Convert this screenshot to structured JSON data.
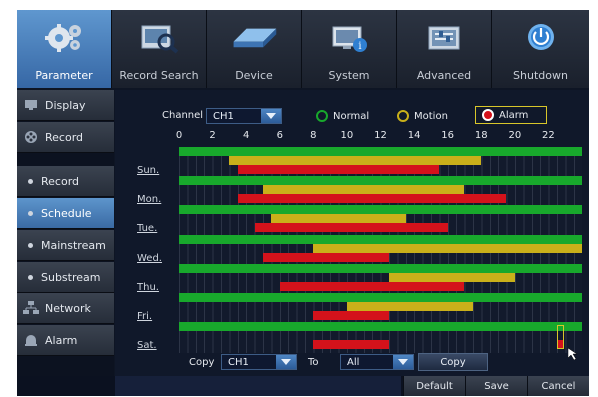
{
  "tabs": [
    {
      "label": "Parameter",
      "icon": "gears-icon",
      "active": true
    },
    {
      "label": "Record Search",
      "icon": "record-search-icon"
    },
    {
      "label": "Device",
      "icon": "hard-drive-icon"
    },
    {
      "label": "System",
      "icon": "system-info-icon"
    },
    {
      "label": "Advanced",
      "icon": "advanced-settings-icon"
    },
    {
      "label": "Shutdown",
      "icon": "power-icon"
    }
  ],
  "sidebar": {
    "items": [
      {
        "label": "Display",
        "icon": "monitor-icon"
      },
      {
        "label": "Record",
        "icon": "film-reel-icon"
      },
      {
        "label": "Record"
      },
      {
        "label": "Schedule",
        "selected": true
      },
      {
        "label": "Mainstream"
      },
      {
        "label": "Substream"
      },
      {
        "label": "Network",
        "icon": "network-icon"
      },
      {
        "label": "Alarm",
        "icon": "alarm-icon"
      }
    ]
  },
  "schedule": {
    "channel_label": "Channel",
    "channel_value": "CH1",
    "legend": {
      "normal": "Normal",
      "motion": "Motion",
      "alarm": "Alarm",
      "selected": "alarm"
    },
    "colors": {
      "normal": "#18a82c",
      "motion": "#c9b01a",
      "alarm": "#d4121b"
    },
    "hour_labels": [
      "0",
      "2",
      "4",
      "6",
      "8",
      "10",
      "12",
      "14",
      "16",
      "18",
      "20",
      "22"
    ],
    "days": [
      {
        "label": "Sun.",
        "normal": [
          [
            0,
            24
          ]
        ],
        "motion": [
          [
            3,
            18
          ]
        ],
        "alarm": [
          [
            3.5,
            15.5
          ]
        ]
      },
      {
        "label": "Mon.",
        "normal": [
          [
            0,
            24
          ]
        ],
        "motion": [
          [
            5,
            17
          ]
        ],
        "alarm": [
          [
            3.5,
            19.5
          ]
        ]
      },
      {
        "label": "Tue.",
        "normal": [
          [
            0,
            24
          ]
        ],
        "motion": [
          [
            5.5,
            13.5
          ]
        ],
        "alarm": [
          [
            4.5,
            16
          ]
        ]
      },
      {
        "label": "Wed.",
        "normal": [
          [
            0,
            24
          ]
        ],
        "motion": [
          [
            8,
            24
          ]
        ],
        "alarm": [
          [
            5,
            12.5
          ]
        ]
      },
      {
        "label": "Thu.",
        "normal": [
          [
            0,
            24
          ]
        ],
        "motion": [
          [
            12.5,
            20
          ]
        ],
        "alarm": [
          [
            6,
            17
          ]
        ]
      },
      {
        "label": "Fri.",
        "normal": [
          [
            0,
            24
          ]
        ],
        "motion": [
          [
            10,
            17.5
          ]
        ],
        "alarm": [
          [
            8,
            12.5
          ]
        ]
      },
      {
        "label": "Sat.",
        "normal": [
          [
            0,
            24
          ]
        ],
        "motion": [],
        "alarm": [
          [
            8,
            12.5
          ]
        ]
      }
    ],
    "copy_label": "Copy",
    "copy_from": "CH1",
    "to_label": "To",
    "copy_to": "All",
    "copy_button": "Copy"
  },
  "footer": {
    "default": "Default",
    "save": "Save",
    "cancel": "Cancel"
  }
}
